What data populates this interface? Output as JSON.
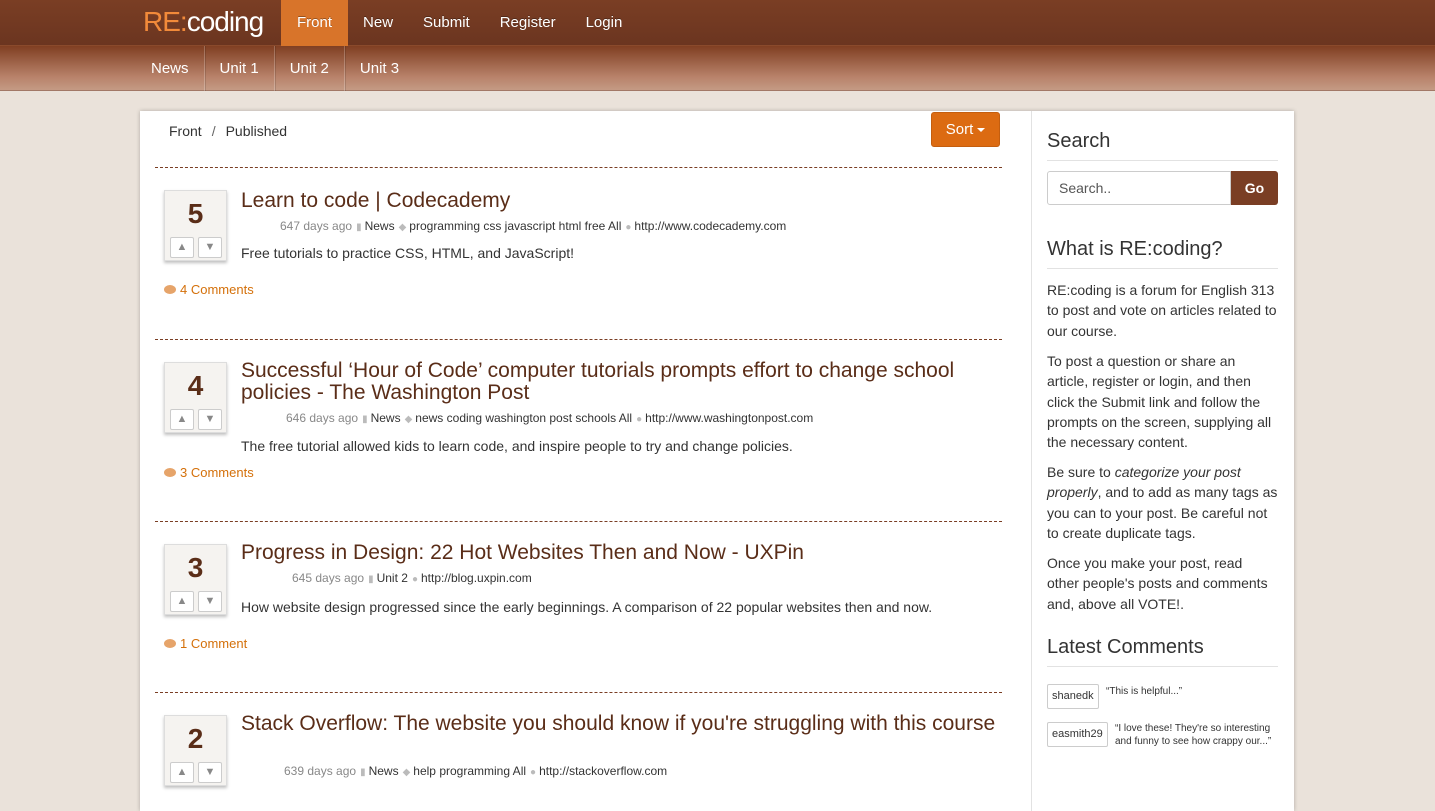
{
  "brand": {
    "re": "RE:",
    "name": "coding"
  },
  "nav": [
    "Front",
    "New",
    "Submit",
    "Register",
    "Login"
  ],
  "subnav": [
    "News",
    "Unit 1",
    "Unit 2",
    "Unit 3"
  ],
  "breadcrumb": {
    "front": "Front",
    "sep": "/",
    "current": "Published"
  },
  "sort_label": "Sort",
  "posts": [
    {
      "score": "5",
      "title": "Learn to code | Codecademy",
      "age": "647 days ago",
      "category": "News",
      "tags": "programming css javascript html free All",
      "url": "http://www.codecademy.com",
      "description": "Free tutorials to practice CSS, HTML, and JavaScript!",
      "comments": "4 Comments"
    },
    {
      "score": "4",
      "title": "Successful ‘Hour of Code’ computer tutorials prompts effort to change school policies - The Washington Post",
      "age": "646 days ago",
      "category": "News",
      "tags": "news coding washington post schools All",
      "url": "http://www.washingtonpost.com",
      "description": "The free tutorial allowed kids to learn code, and inspire people to try and change policies.",
      "comments": "3 Comments"
    },
    {
      "score": "3",
      "title": "Progress in Design: 22 Hot Websites Then and Now - UXPin",
      "age": "645 days ago",
      "category": "Unit 2",
      "url": "http://blog.uxpin.com",
      "description": "How website design progressed since the early beginnings. A comparison of 22 popular websites then and now.",
      "comments": "1 Comment"
    },
    {
      "score": "2",
      "title": "Stack Overflow: The website you should know if you're struggling with this course",
      "age": "639 days ago",
      "category": "News",
      "tags": "help programming All",
      "url": "http://stackoverflow.com"
    }
  ],
  "sidebar": {
    "search_title": "Search",
    "search_placeholder": "Search..",
    "go_label": "Go",
    "about_title": "What is RE:coding?",
    "about_p1": "RE:coding is a forum for English 313 to post and vote on articles related to our course.",
    "about_p2": "To post a question or share an article, register or login, and then click the Submit link and follow the prompts on the screen, supplying all the necessary content.",
    "about_p3_pre": "Be sure to ",
    "about_p3_em": "categorize your post properly",
    "about_p3_post": ", and to add as many tags as you can to your post. Be careful not to create duplicate tags.",
    "about_p4": "Once you make your post, read other people's posts and comments and, above all VOTE!.",
    "latest_title": "Latest Comments",
    "latest": [
      {
        "user": "shanedk",
        "text": "“This is helpful...”"
      },
      {
        "user": "easmith29",
        "text": "“I love these! They're so interesting and funny to see how crappy our...”"
      }
    ]
  },
  "icons": {
    "thumbs_up": "thumbs-up-icon",
    "thumbs_down": "thumbs-down-icon",
    "folder": "folder-icon",
    "tag": "tag-icon",
    "link": "link-icon",
    "comment": "comment-icon"
  },
  "colors": {
    "brand_brown": "#7a3e24",
    "accent_orange": "#dc6b12",
    "title_brown": "#5a2d18"
  }
}
